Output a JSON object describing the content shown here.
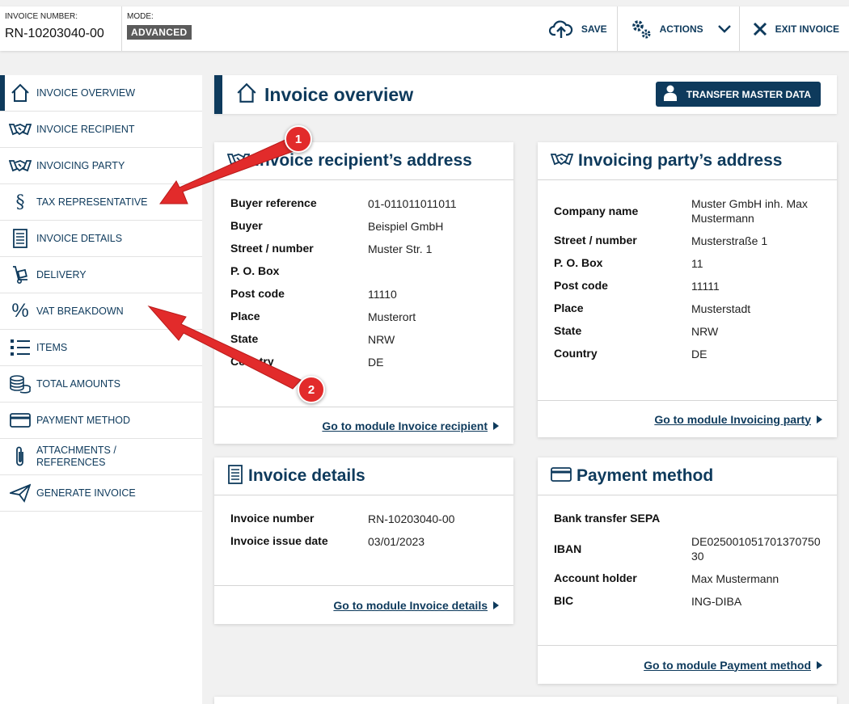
{
  "header": {
    "invoice_number_label": "INVOICE NUMBER:",
    "invoice_number": "RN-10203040-00",
    "mode_label": "MODE:",
    "mode_value": "ADVANCED",
    "save_label": "SAVE",
    "actions_label": "ACTIONS",
    "exit_label": "EXIT INVOICE"
  },
  "sidebar": {
    "items": [
      {
        "label": "INVOICE OVERVIEW",
        "icon": "house-icon"
      },
      {
        "label": "INVOICE RECIPIENT",
        "icon": "handshake-icon"
      },
      {
        "label": "INVOICING PARTY",
        "icon": "handshake-icon"
      },
      {
        "label": "TAX REPRESENTATIVE",
        "icon": "section-sign-icon"
      },
      {
        "label": "INVOICE DETAILS",
        "icon": "document-icon"
      },
      {
        "label": "DELIVERY",
        "icon": "hand-truck-icon"
      },
      {
        "label": "VAT BREAKDOWN",
        "icon": "percent-icon"
      },
      {
        "label": "ITEMS",
        "icon": "list-icon"
      },
      {
        "label": "TOTAL AMOUNTS",
        "icon": "coins-icon"
      },
      {
        "label": "PAYMENT METHOD",
        "icon": "credit-card-icon"
      },
      {
        "label": "ATTACHMENTS / REFERENCES",
        "icon": "paperclip-icon"
      },
      {
        "label": "GENERATE INVOICE",
        "icon": "paper-plane-icon"
      }
    ]
  },
  "page": {
    "title": "Invoice overview",
    "transfer_button": "TRANSFER MASTER DATA"
  },
  "recipient": {
    "title": "Invoice recipient’s address",
    "rows": [
      {
        "k": "Buyer reference",
        "v": "01-011011011011"
      },
      {
        "k": "Buyer",
        "v": "Beispiel GmbH"
      },
      {
        "k": "Street / number",
        "v": "Muster Str. 1"
      },
      {
        "k": "P. O. Box",
        "v": ""
      },
      {
        "k": "Post code",
        "v": "11110"
      },
      {
        "k": "Place",
        "v": "Musterort"
      },
      {
        "k": "State",
        "v": "NRW"
      },
      {
        "k": "Country",
        "v": "DE"
      }
    ],
    "link": "Go to module Invoice recipient"
  },
  "party": {
    "title": "Invoicing party’s address",
    "rows": [
      {
        "k": "Company name",
        "v": "Muster GmbH inh. Max Mustermann"
      },
      {
        "k": "Street / number",
        "v": "Musterstraße 1"
      },
      {
        "k": "P. O. Box",
        "v": "11"
      },
      {
        "k": "Post code",
        "v": "11111"
      },
      {
        "k": "Place",
        "v": "Musterstadt"
      },
      {
        "k": "State",
        "v": "NRW"
      },
      {
        "k": "Country",
        "v": "DE"
      }
    ],
    "link": "Go to module Invoicing party"
  },
  "details": {
    "title": "Invoice details",
    "rows": [
      {
        "k": "Invoice number",
        "v": "RN-10203040-00"
      },
      {
        "k": "Invoice issue date",
        "v": "03/01/2023"
      }
    ],
    "link": "Go to module Invoice details"
  },
  "payment": {
    "title": "Payment method",
    "rows": [
      {
        "k": "Bank transfer SEPA",
        "v": ""
      },
      {
        "k": "IBAN",
        "v": "DE02500105170137075030"
      },
      {
        "k": "Account holder",
        "v": "Max Mustermann"
      },
      {
        "k": "BIC",
        "v": "ING-DIBA"
      }
    ],
    "link": "Go to module Payment method"
  },
  "annotations": {
    "marker1": "1",
    "marker2": "2",
    "color": "#e22b2b"
  },
  "colors": {
    "primary": "#0e3a5c",
    "background": "#f1f1f1"
  }
}
